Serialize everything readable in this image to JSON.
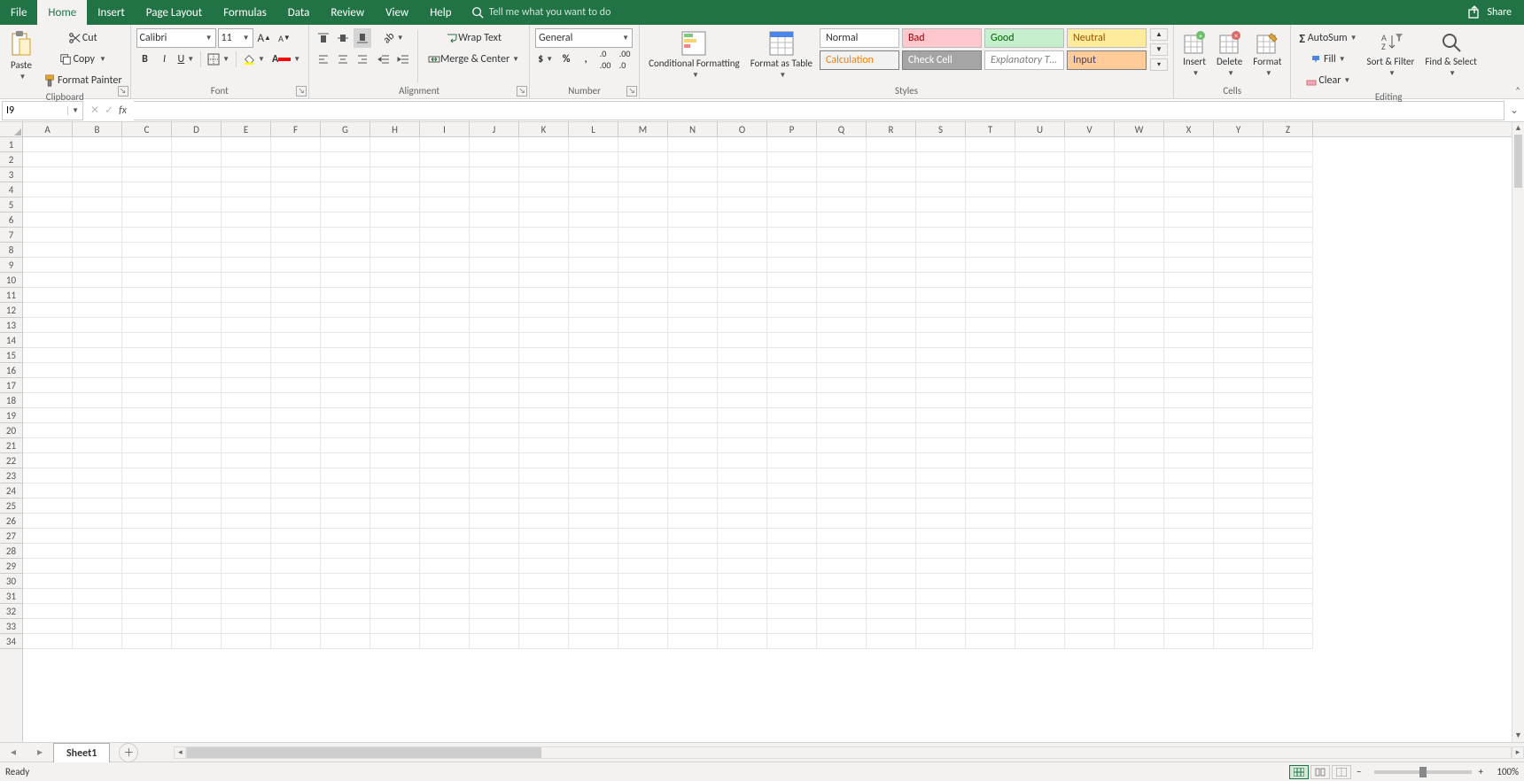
{
  "tabs": {
    "file": "File",
    "home": "Home",
    "insert": "Insert",
    "page": "Page Layout",
    "formulas": "Formulas",
    "data": "Data",
    "review": "Review",
    "view": "View",
    "help": "Help"
  },
  "tellme_placeholder": "Tell me what you want to do",
  "share": "Share",
  "clipboard": {
    "paste": "Paste",
    "cut": "Cut",
    "copy": "Copy",
    "painter": "Format Painter",
    "label": "Clipboard"
  },
  "font": {
    "name": "Calibri",
    "size": "11",
    "label": "Font"
  },
  "alignment": {
    "wrap": "Wrap Text",
    "merge": "Merge & Center",
    "label": "Alignment"
  },
  "number": {
    "format": "General",
    "label": "Number"
  },
  "styles": {
    "cond": "Conditional Formatting",
    "table": "Format as Table",
    "label": "Styles",
    "items": {
      "normal": "Normal",
      "bad": "Bad",
      "good": "Good",
      "neutral": "Neutral",
      "calc": "Calculation",
      "check": "Check Cell",
      "expl": "Explanatory T…",
      "input": "Input"
    }
  },
  "cells": {
    "insert": "Insert",
    "delete": "Delete",
    "format": "Format",
    "label": "Cells"
  },
  "editing": {
    "autosum": "AutoSum",
    "fill": "Fill",
    "clear": "Clear",
    "sort": "Sort & Filter",
    "find": "Find & Select",
    "label": "Editing"
  },
  "namebox": "I9",
  "columns": [
    "A",
    "B",
    "C",
    "D",
    "E",
    "F",
    "G",
    "H",
    "I",
    "J",
    "K",
    "L",
    "M",
    "N",
    "O",
    "P",
    "Q",
    "R",
    "S",
    "T",
    "U",
    "V",
    "W",
    "X",
    "Y",
    "Z"
  ],
  "row_count": 34,
  "sheet": {
    "name": "Sheet1"
  },
  "status": {
    "ready": "Ready",
    "zoom": "100%"
  }
}
